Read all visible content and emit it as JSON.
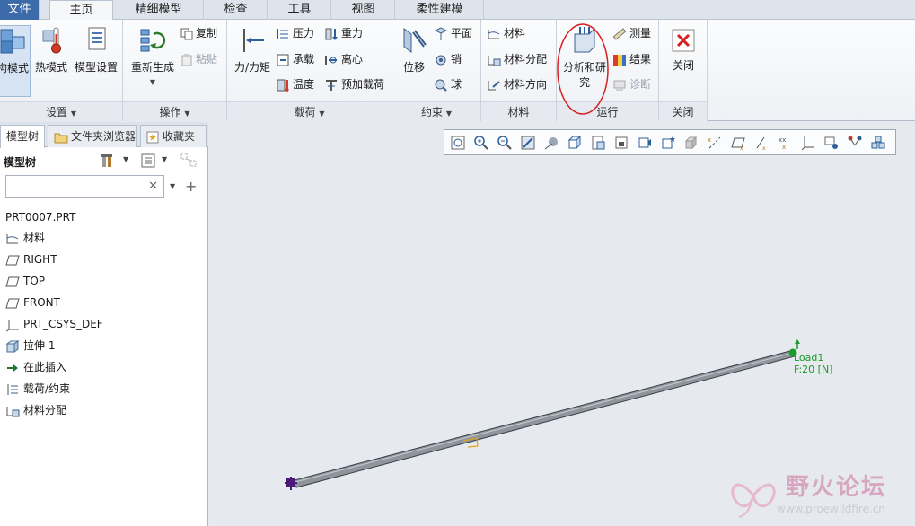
{
  "tabs": [
    {
      "label": "文件"
    },
    {
      "label": "主页"
    },
    {
      "label": "精细模型"
    },
    {
      "label": "检查"
    },
    {
      "label": "工具"
    },
    {
      "label": "视图"
    },
    {
      "label": "柔性建模"
    }
  ],
  "ribbon": {
    "setup": {
      "group_label": "设置",
      "struct_mode": "构模式",
      "thermal_mode": "热模式",
      "model_setup": "模型设置"
    },
    "operations": {
      "group_label": "操作",
      "regenerate": "重新生成",
      "copy": "复制",
      "paste": "粘贴"
    },
    "loads": {
      "group_label": "载荷",
      "force_moment": "力/力矩",
      "pressure": "压力",
      "gravity": "重力",
      "bearing": "承载",
      "centrifugal": "离心",
      "temperature": "温度",
      "preload": "预加载荷"
    },
    "constraints": {
      "group_label": "约束",
      "displacement": "位移",
      "planar": "平面",
      "pin": "销",
      "ball": "球"
    },
    "material": {
      "group_label": "材料",
      "material": "材料",
      "material_assign": "材料分配",
      "material_orientation": "材料方向"
    },
    "run": {
      "group_label": "运行",
      "analysis_study": "分析和研究",
      "measure": "测量",
      "results": "结果",
      "diagnostics": "诊断"
    },
    "close": {
      "group_label": "关闭",
      "close": "关闭"
    }
  },
  "left_panel": {
    "tabs": [
      "模型树",
      "文件夹浏览器",
      "收藏夹"
    ],
    "tree_title": "模型树",
    "search_value": "",
    "items": [
      {
        "label": "PRT0007.PRT",
        "icon": "part-icon"
      },
      {
        "label": "材料",
        "icon": "material-icon"
      },
      {
        "label": "RIGHT",
        "icon": "datum-plane-icon"
      },
      {
        "label": "TOP",
        "icon": "datum-plane-icon"
      },
      {
        "label": "FRONT",
        "icon": "datum-plane-icon"
      },
      {
        "label": "PRT_CSYS_DEF",
        "icon": "csys-icon"
      },
      {
        "label": "拉伸 1",
        "icon": "extrude-icon"
      },
      {
        "label": "在此插入",
        "icon": "insert-here-icon"
      },
      {
        "label": "载荷/约束",
        "icon": "loads-constraints-icon"
      },
      {
        "label": "材料分配",
        "icon": "material-assign-icon"
      }
    ]
  },
  "graphics": {
    "load_name": "Load1",
    "load_value": "F:20 [N]"
  },
  "watermark": {
    "text": "野火论坛",
    "url": "www.proewildfire.cn"
  },
  "colors": {
    "accent": "#3d6aa8",
    "load_green": "#1c9a2c",
    "constraint_purple": "#4a1a7a",
    "annotation_red": "#d81e1e"
  }
}
